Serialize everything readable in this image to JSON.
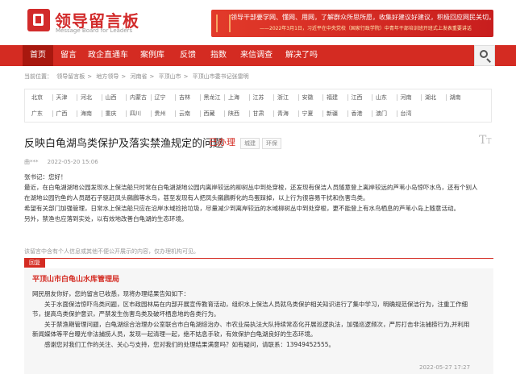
{
  "header": {
    "logo_title": "领导留言板",
    "logo_subtitle": "Message Board for Leaders",
    "banner_line1": "领导干部要学网、懂网、用网，了解群众所思所愿，收集好建议好建议，积极回应网民关切。",
    "banner_line2": "——2022年3月1日，习近平在中央党校（国家行政学院）中青年干部培训班开班式上发表重要讲话"
  },
  "nav": {
    "items": [
      "首页",
      "留言",
      "政企直通车",
      "案例库",
      "反馈",
      "指数",
      "来信调查",
      "解决了吗"
    ],
    "active": "首页"
  },
  "breadcrumb": {
    "prefix": "当前位置：",
    "items": [
      "领导留言板",
      "地方领导",
      "河南省",
      "平顶山市",
      "平顶山市委书记张雷明"
    ],
    "sep": ">"
  },
  "regions": {
    "row1": [
      "北京",
      "天津",
      "河北",
      "山西",
      "内蒙古",
      "辽宁",
      "吉林",
      "黑龙江",
      "上海",
      "江苏",
      "浙江",
      "安徽",
      "福建",
      "江西",
      "山东",
      "河南",
      "湖北",
      "湖南"
    ],
    "row2": [
      "广东",
      "广西",
      "海南",
      "重庆",
      "四川",
      "贵州",
      "云南",
      "西藏",
      "陕西",
      "甘肃",
      "青海",
      "宁夏",
      "新疆",
      "香港",
      "澳门",
      "台湾"
    ]
  },
  "message": {
    "title": "反映白龟湖鸟类保护及落实禁渔规定的问题",
    "status": "已办理",
    "tag1": "城建",
    "tag2": "环保",
    "author": "曲***",
    "date": "2022-05-20 15:06",
    "greeting": "张书记：您好！",
    "paragraphs": [
      "最近，在白龟湖湖地公园发现水上保洁船只时常在白龟湖湖地公园内离岸较远的柳树丛中到处穿梭，还发现有保洁人员随意登上离岸较远的芦苇小岛惊吓水鸟，还有个别人",
      "在湖地公园钓鱼的人员踏石子驱赶凤头鸊鷉等水鸟，甚至发现有人把凤头鸊鷉孵化的鸟蛋踩掉，以上行为很容易干扰和伤害鸟类。",
      "希望有关部门加强管理，日常水上保洁船只应在沿岸水域捡拾垃圾，尽量减少到离岸较远的水域柳树丛中到处穿梭，更不能登上有水鸟栖息的芦苇小岛上随意活动。",
      "另外，禁渔也应落到实处，以有效地改善白龟湖的生态环境。"
    ],
    "note": "该留言中含有个人信息或其他不便公开展示的内容，仅办理机构可见。"
  },
  "reply": {
    "label": "回复",
    "org": "平顶山市白龟山水库管理局",
    "paragraphs": [
      "网民朋友你好，您的留言已收悉，现将办理结果告知如下：",
      "　　关于水面保洁惊吓鸟类问题，区市政园林局在内部开展宣传教育活动，组织水上保洁人员就鸟类保护相关知识进行了集中学习，明确规范保洁行为，注重工作细",
      "节，提高鸟类保护意识，严禁发生伤害鸟类及破坏栖息地的各类行为。",
      "　　关于禁渔期管理问题，白龟湖综合治理办公室联合市白龟湖综治办、市农业局执法大队持续常态化开展巡逻执法，加强巡逻频次，严厉打击非法捕捞行为,并利用",
      "新闻媒体等平台曝光非法捕捞人员，发现一起清理一起，绝不姑息手软，有效保护白龟湖良好的生态环境。",
      "　　感谢您对我们工作的关注、关心与支持，您对我们的处理结果满意吗？如有疑问，请联系：13949452555。"
    ],
    "date": "2022-05-27 17:27"
  }
}
